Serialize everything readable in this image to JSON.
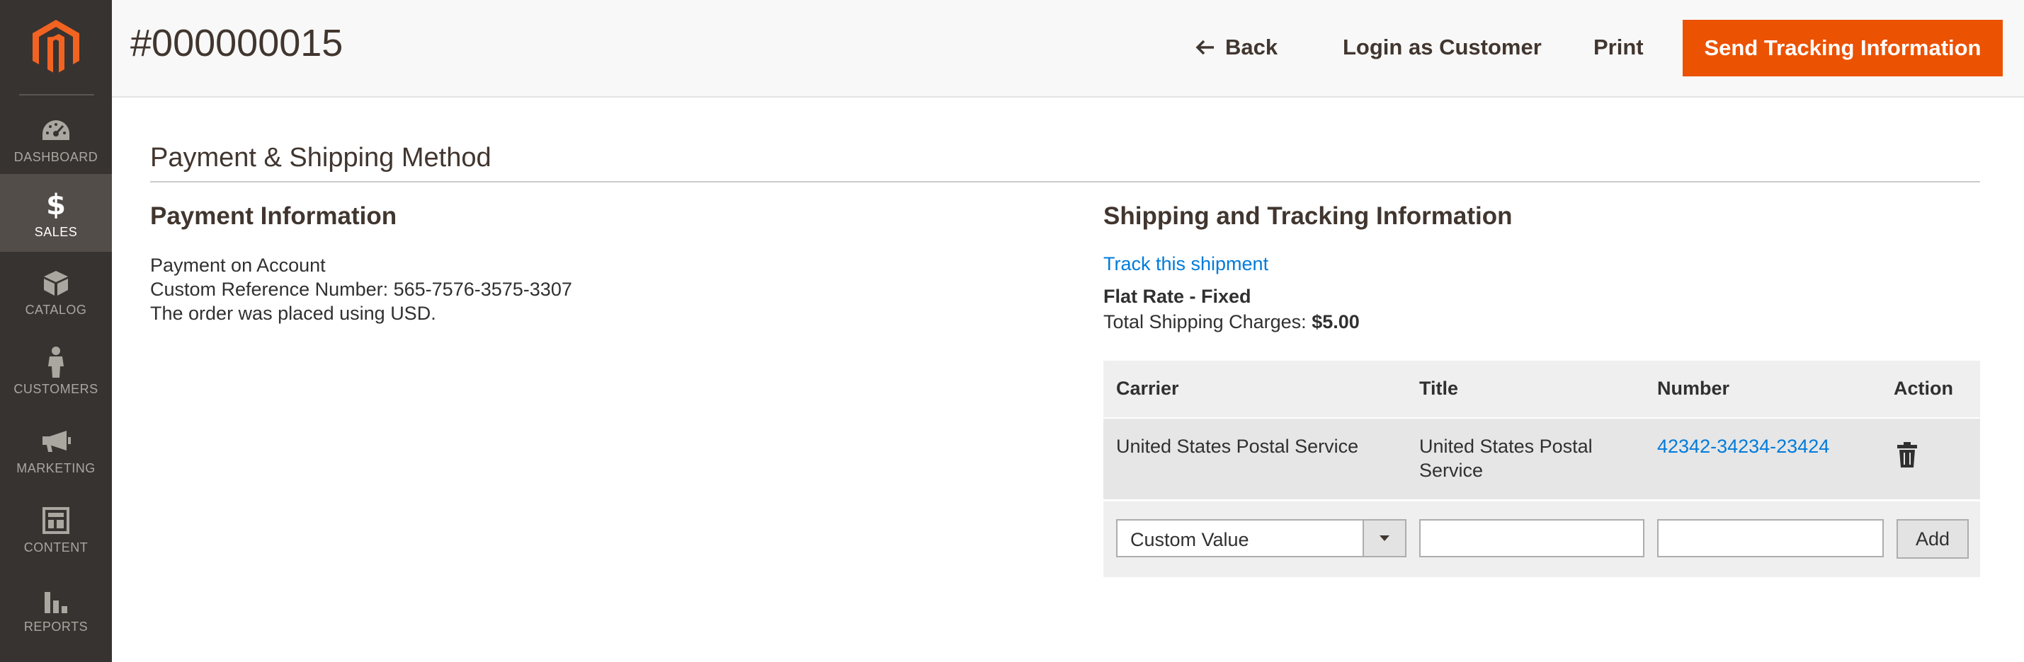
{
  "sidebar": {
    "logo": "magento-logo",
    "items": [
      {
        "label": "DASHBOARD",
        "icon": "dashboard-icon",
        "active": false
      },
      {
        "label": "SALES",
        "icon": "dollar-icon",
        "active": true
      },
      {
        "label": "CATALOG",
        "icon": "box-icon",
        "active": false
      },
      {
        "label": "CUSTOMERS",
        "icon": "person-icon",
        "active": false
      },
      {
        "label": "MARKETING",
        "icon": "megaphone-icon",
        "active": false
      },
      {
        "label": "CONTENT",
        "icon": "layout-icon",
        "active": false
      },
      {
        "label": "REPORTS",
        "icon": "bar-chart-icon",
        "active": false
      }
    ]
  },
  "header": {
    "title": "#000000015",
    "back_label": "Back",
    "login_label": "Login as Customer",
    "print_label": "Print",
    "send_label": "Send Tracking Information"
  },
  "section": {
    "title": "Payment & Shipping Method"
  },
  "payment": {
    "title": "Payment Information",
    "method": "Payment on Account",
    "reference": "Custom Reference Number: 565-7576-3575-3307",
    "currency_note": "The order was placed using USD."
  },
  "shipping": {
    "title": "Shipping and Tracking Information",
    "track_link": "Track this shipment",
    "method": "Flat Rate - Fixed",
    "charges_label": "Total Shipping Charges: ",
    "charges_value": "$5.00"
  },
  "tracking_table": {
    "headers": {
      "carrier": "Carrier",
      "title": "Title",
      "number": "Number",
      "action": "Action"
    },
    "rows": [
      {
        "carrier": "United States Postal Service",
        "title_line1": "United States Postal",
        "title_line2": "Service",
        "number": "42342-34234-23424"
      }
    ],
    "new_row": {
      "carrier_value": "Custom Value",
      "title_value": "",
      "number_value": "",
      "add_label": "Add"
    }
  },
  "colors": {
    "accent": "#eb5202",
    "sidebar_bg": "#373330",
    "link": "#007bdb"
  }
}
